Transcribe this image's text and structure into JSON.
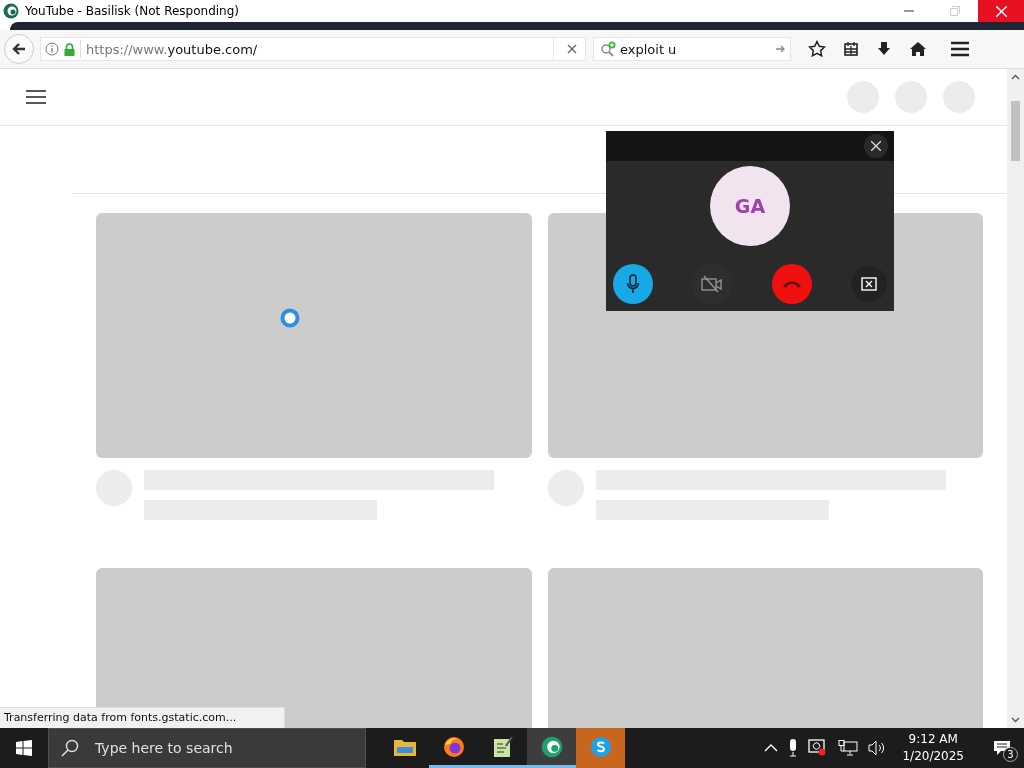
{
  "window": {
    "title": "YouTube - Basilisk (Not Responding)"
  },
  "toolbar": {
    "url_prefix": "https://www.",
    "url_host": "youtube.com/",
    "search": {
      "value": "exploit u"
    }
  },
  "status_bar": {
    "text": "Transferring data from fonts.gstatic.com..."
  },
  "call": {
    "initials": "GA",
    "controls": [
      {
        "kind": "mic",
        "on": true
      },
      {
        "kind": "camera",
        "on": false
      },
      {
        "kind": "hangup"
      },
      {
        "kind": "minimize"
      }
    ]
  },
  "taskbar": {
    "search": {
      "placeholder": "Type here to search"
    },
    "apps": [
      {
        "kind": "folder",
        "running": false,
        "selected": false,
        "flashing": false
      },
      {
        "kind": "firefox",
        "running": true,
        "selected": false,
        "flashing": false
      },
      {
        "kind": "notepad",
        "running": true,
        "selected": false,
        "flashing": false
      },
      {
        "kind": "basilisk",
        "running": true,
        "selected": true,
        "flashing": false
      },
      {
        "kind": "skype",
        "running": false,
        "selected": false,
        "flashing": true
      }
    ],
    "clock": {
      "time": "9:12 AM",
      "date": "1/20/2025"
    },
    "notifications": {
      "count": "3"
    }
  }
}
